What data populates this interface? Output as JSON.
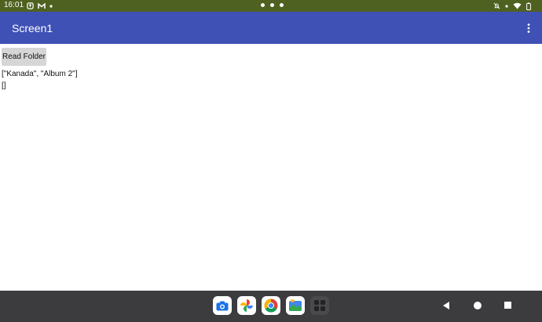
{
  "status_bar": {
    "time": "16:01",
    "left_icons": [
      "sync-icon",
      "gmail-icon",
      "dot-icon"
    ],
    "right_icons": [
      "bell-off-icon",
      "dot-icon",
      "wifi-icon",
      "battery-icon"
    ]
  },
  "app_bar": {
    "title": "Screen1",
    "menu_icon": "more-vert-icon",
    "background": "#3f51b5"
  },
  "content": {
    "read_button_label": "Read Folder",
    "result_line_1": "[\"Kanada\", \"Album 2\"]",
    "result_line_2": "[]"
  },
  "taskbar": {
    "apps": [
      "camera-icon",
      "photos-icon",
      "chrome-icon",
      "files-icon",
      "app-drawer-icon"
    ]
  },
  "colors": {
    "status_bar": "#4f6120",
    "nav_bar": "#3c3c3f",
    "button": "#d6d6d6"
  }
}
